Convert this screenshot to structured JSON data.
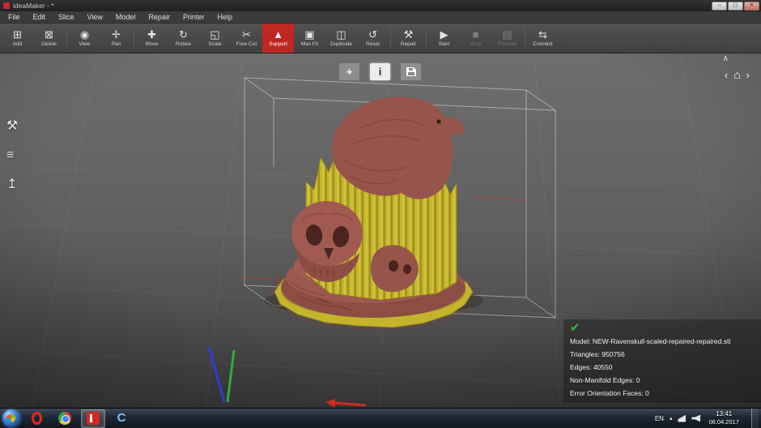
{
  "window": {
    "title": "ideaMaker - *",
    "controls": {
      "minimize": "─",
      "maximize": "▢",
      "close": "✕"
    }
  },
  "menubar": {
    "items": [
      "File",
      "Edit",
      "Slice",
      "View",
      "Model",
      "Repair",
      "Printer",
      "Help"
    ]
  },
  "toolbar": {
    "items": [
      {
        "label": "Add",
        "icon": "add-icon"
      },
      {
        "label": "Delete",
        "icon": "delete-icon"
      },
      {
        "label": "View",
        "icon": "view-icon"
      },
      {
        "label": "Pan",
        "icon": "pan-icon"
      },
      {
        "label": "Move",
        "icon": "move-icon"
      },
      {
        "label": "Rotate",
        "icon": "rotate-icon"
      },
      {
        "label": "Scale",
        "icon": "scale-icon"
      },
      {
        "label": "Free Cut",
        "icon": "freecut-icon"
      },
      {
        "label": "Support",
        "icon": "support-icon",
        "active": true
      },
      {
        "label": "Max Fit",
        "icon": "maxfit-icon"
      },
      {
        "label": "Duplicate",
        "icon": "duplicate-icon"
      },
      {
        "label": "Reset",
        "icon": "reset-icon"
      },
      {
        "label": "Repair",
        "icon": "repair-icon"
      },
      {
        "label": "Start",
        "icon": "start-icon"
      },
      {
        "label": "Stop",
        "icon": "stop-icon",
        "disabled": true
      },
      {
        "label": "Preview",
        "icon": "preview-icon",
        "disabled": true
      },
      {
        "label": "Connect",
        "icon": "connect-icon"
      }
    ]
  },
  "viewport": {
    "top_buttons": {
      "add": "+",
      "info": "i"
    },
    "nav": {
      "prev": "‹",
      "home": "⌂",
      "next": "›",
      "collapse": "∧"
    }
  },
  "info_panel": {
    "lines": [
      "Model: NEW-Ravenskull-scaled-repaired-repaired.stl",
      "Triangles: 950756",
      "Edges: 40550",
      "Non-Manifold Edges: 0",
      "Error Orientation Faces: 0"
    ],
    "check": "✔"
  },
  "taskbar": {
    "apps": [
      {
        "name": "opera"
      },
      {
        "name": "chrome"
      },
      {
        "name": "ideamaker",
        "active": true
      },
      {
        "name": "browser-c"
      }
    ],
    "tray": {
      "language": "EN",
      "time": "13:41",
      "date": "06.04.2017"
    }
  },
  "colors": {
    "accent_red": "#bf2722",
    "model": "#96544b",
    "support_yellow": "#c6b62c"
  }
}
